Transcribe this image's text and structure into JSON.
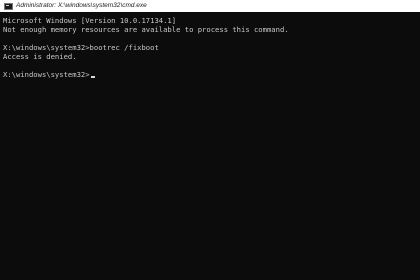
{
  "window": {
    "title": "Administrator: X:\\windows\\system32\\cmd.exe",
    "icon": "cmd-icon"
  },
  "console": {
    "lines": [
      "Microsoft Windows [Version 10.0.17134.1]",
      "Not enough memory resources are available to process this command.",
      "",
      "X:\\windows\\system32>bootrec /fixboot",
      "Access is denied.",
      "",
      "X:\\windows\\system32>"
    ]
  },
  "colors": {
    "background": "#0c0c0c",
    "text": "#c8c8c8",
    "titlebar": "#ffffff"
  }
}
